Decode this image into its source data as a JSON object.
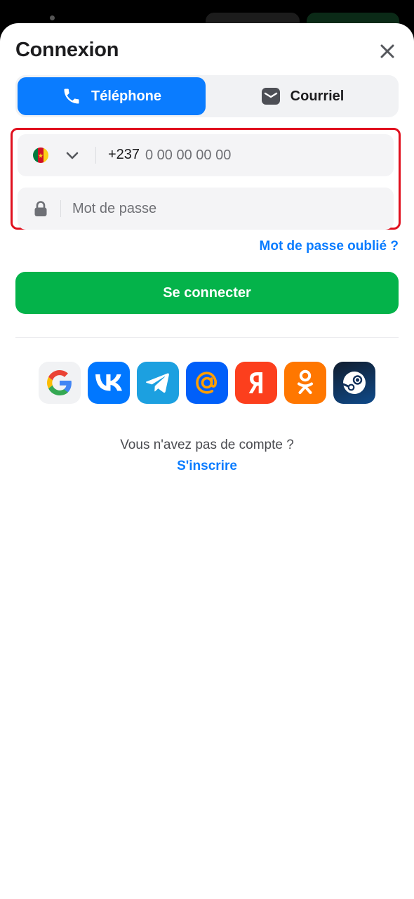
{
  "header": {
    "title": "Connexion"
  },
  "tabs": {
    "phone_label": "Téléphone",
    "email_label": "Courriel",
    "active": "phone"
  },
  "phone_field": {
    "country_code": "+237",
    "placeholder": "0 00 00 00 00",
    "value": "",
    "flag_country": "Cameroon",
    "flag_colors": [
      "#007a3d",
      "#ce1126",
      "#fcd116"
    ]
  },
  "password_field": {
    "placeholder": "Mot de passe",
    "value": ""
  },
  "forgot_password_label": "Mot de passe oublié ?",
  "login_button_label": "Se connecter",
  "social_logins": [
    {
      "name": "google",
      "icon": "google-icon",
      "bg": "#f1f2f4"
    },
    {
      "name": "vk",
      "icon": "vk-icon",
      "bg": "#0077ff"
    },
    {
      "name": "telegram",
      "icon": "telegram-icon",
      "bg": "#1ca0e0"
    },
    {
      "name": "mail",
      "icon": "at-icon",
      "bg": "#005ff9"
    },
    {
      "name": "yandex",
      "icon": "yandex-icon",
      "bg": "#fc3f1d"
    },
    {
      "name": "odnoklassniki",
      "icon": "odnoklassniki-icon",
      "bg": "#ff7700"
    },
    {
      "name": "steam",
      "icon": "steam-icon",
      "bg": "#10356a"
    }
  ],
  "footer": {
    "no_account_text": "Vous n'avez pas de compte ?",
    "signup_label": "S'inscrire"
  },
  "colors": {
    "primary_blue": "#0a7cff",
    "green": "#04b34a",
    "highlight_red": "#e0101e"
  }
}
